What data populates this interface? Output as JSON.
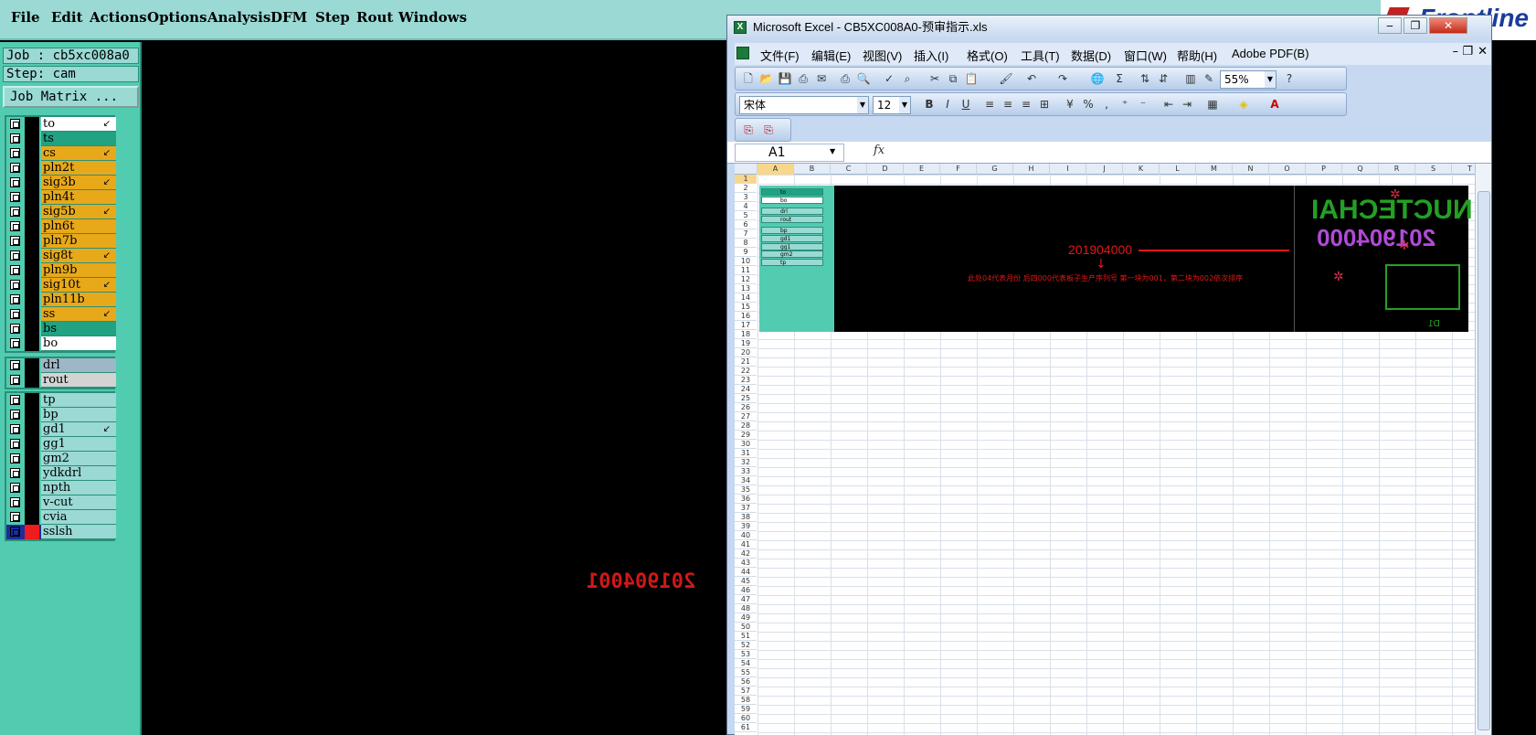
{
  "menubar": {
    "items": [
      "File",
      "Edit",
      "Actions",
      "Options",
      "Analysis",
      "DFM",
      "Step",
      "Rout",
      "Windows"
    ],
    "logo": "Frontline"
  },
  "job_panel": {
    "job": "Job : cb5xc008a0",
    "step": "Step: cam",
    "job_matrix": "Job Matrix ...",
    "board_layers": [
      {
        "name": "to",
        "color": "#ffffff",
        "arrow": true
      },
      {
        "name": "ts",
        "color": "#21a282",
        "arrow": false
      },
      {
        "name": "cs",
        "color": "#e7a91a",
        "arrow": true
      },
      {
        "name": "pln2t",
        "color": "#e7a91a",
        "arrow": false
      },
      {
        "name": "sig3b",
        "color": "#e7a91a",
        "arrow": true
      },
      {
        "name": "pln4t",
        "color": "#e7a91a",
        "arrow": false
      },
      {
        "name": "sig5b",
        "color": "#e7a91a",
        "arrow": true
      },
      {
        "name": "pln6t",
        "color": "#e7a91a",
        "arrow": false
      },
      {
        "name": "pln7b",
        "color": "#e7a91a",
        "arrow": false
      },
      {
        "name": "sig8t",
        "color": "#e7a91a",
        "arrow": true
      },
      {
        "name": "pln9b",
        "color": "#e7a91a",
        "arrow": false
      },
      {
        "name": "sig10t",
        "color": "#e7a91a",
        "arrow": true
      },
      {
        "name": "pln11b",
        "color": "#e7a91a",
        "arrow": false
      },
      {
        "name": "ss",
        "color": "#e7a91a",
        "arrow": true
      },
      {
        "name": "bs",
        "color": "#21a282",
        "arrow": false
      },
      {
        "name": "bo",
        "color": "#ffffff",
        "arrow": false
      }
    ],
    "drill_layers": [
      {
        "name": "drl",
        "color": "#9fb6c7",
        "arrow": false
      },
      {
        "name": "rout",
        "color": "#d3d3d3",
        "arrow": false
      }
    ],
    "misc_layers": [
      {
        "name": "tp",
        "color": "#9ad9d4",
        "arrow": false
      },
      {
        "name": "bp",
        "color": "#9ad9d4",
        "arrow": false
      },
      {
        "name": "gd1",
        "color": "#9ad9d4",
        "arrow": true
      },
      {
        "name": "gg1",
        "color": "#9ad9d4",
        "arrow": false
      },
      {
        "name": "gm2",
        "color": "#9ad9d4",
        "arrow": false
      },
      {
        "name": "ydkdrl",
        "color": "#9ad9d4",
        "arrow": false
      },
      {
        "name": "npth",
        "color": "#9ad9d4",
        "arrow": false
      },
      {
        "name": "v-cut",
        "color": "#9ad9d4",
        "arrow": false
      },
      {
        "name": "cvia",
        "color": "#9ad9d4",
        "arrow": false
      },
      {
        "name": "sslsh",
        "color": "#9ad9d4",
        "arrow": false,
        "active": true
      }
    ]
  },
  "canvas": {
    "number": "201904001"
  },
  "excel": {
    "title": "Microsoft Excel - CB5XC008A0-预审指示.xls",
    "menu": [
      "文件(F)",
      "编辑(E)",
      "视图(V)",
      "插入(I)",
      "格式(O)",
      "工具(T)",
      "数据(D)",
      "窗口(W)",
      "帮助(H)",
      "Adobe PDF(B)"
    ],
    "zoom": "55%",
    "font": "宋体",
    "font_size": "12",
    "name_box": "A1",
    "fx": "fx",
    "columns": [
      "A",
      "B",
      "C",
      "D",
      "E",
      "F",
      "G",
      "H",
      "I",
      "J",
      "K",
      "L",
      "M",
      "N",
      "O",
      "P",
      "Q",
      "R",
      "S",
      "T"
    ],
    "row_count": 61,
    "embedded": {
      "number1": "201904000",
      "note": "此处04代表月份 后四000代表板子生产序列号 第一块为001，第二块为002依次排序",
      "mirrored_brand": "NUCTECHAI",
      "mirrored_number": "201904000",
      "d1": "D1",
      "mini_layers": [
        "to",
        "bo",
        "drl",
        "rout",
        "bp",
        "gd1",
        "gg1",
        "gm2",
        "tp"
      ]
    }
  }
}
